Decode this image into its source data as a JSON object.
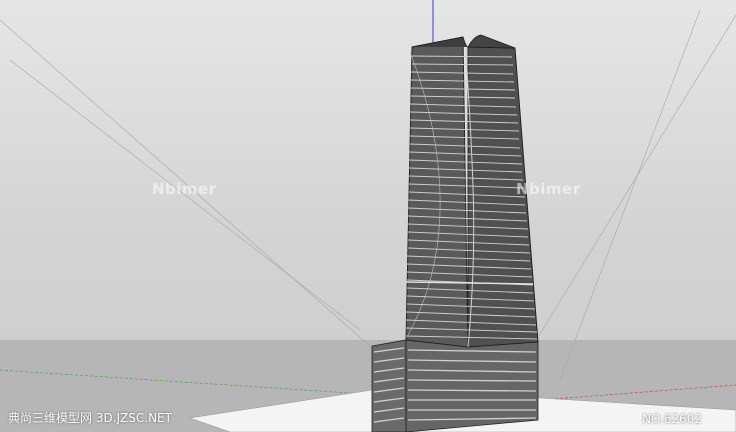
{
  "viewport": {
    "sky_color": "#dcdcdc",
    "ground_color": "#b6b6b6",
    "building_color": "#5a5a5a",
    "axis_blue": "#3a3ad0",
    "axis_red": "#c84a4a",
    "axis_green": "#4fa24f"
  },
  "watermarks": {
    "left": "Nbimer",
    "right": "Nbimer"
  },
  "footer": {
    "site": "典尚三维模型网 3D.JZSC.NET",
    "model_no": "NO.62602"
  }
}
